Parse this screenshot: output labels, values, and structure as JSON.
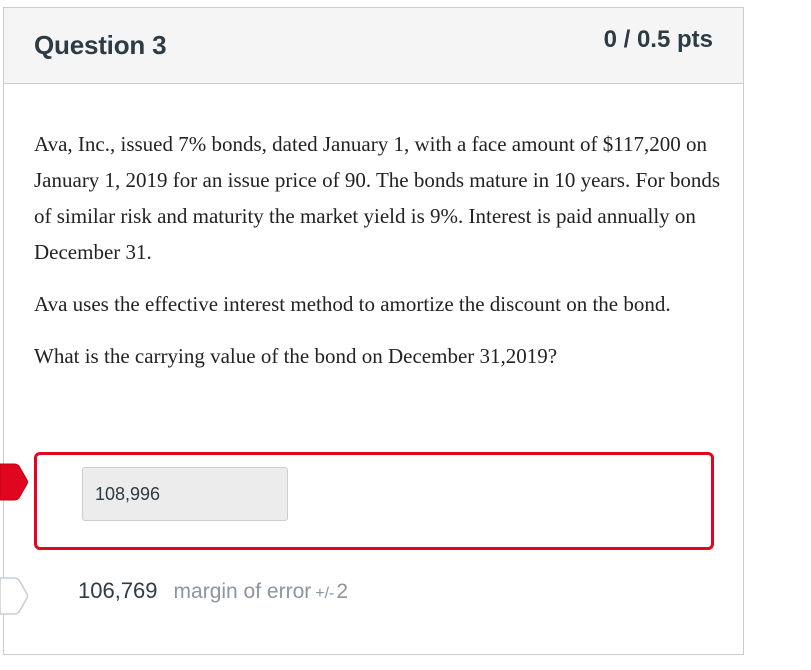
{
  "question": {
    "title": "Question 3",
    "points": "0 / 0.5 pts",
    "paragraphs": [
      "Ava, Inc., issued 7% bonds, dated January 1, with a face amount of $117,200 on January 1, 2019 for an issue price of 90. The bonds mature  in 10 years. For bonds of similar risk and maturity the market yield is 9%. Interest is paid annually on December 31.",
      "Ava uses the effective interest method to amortize the discount on the bond.",
      "What is the carrying value of the bond on December 31,2019?"
    ]
  },
  "answer": {
    "user_value": "108,996",
    "status_color": "#e0061f"
  },
  "correct_answer": {
    "value": "106,769",
    "margin_label": "margin of error",
    "margin_sign": "+/-",
    "margin_value": "2"
  },
  "icons": {
    "wrong_arrow": "wrong-answer-arrow-icon",
    "correct_arrow": "correct-answer-arrow-icon"
  }
}
